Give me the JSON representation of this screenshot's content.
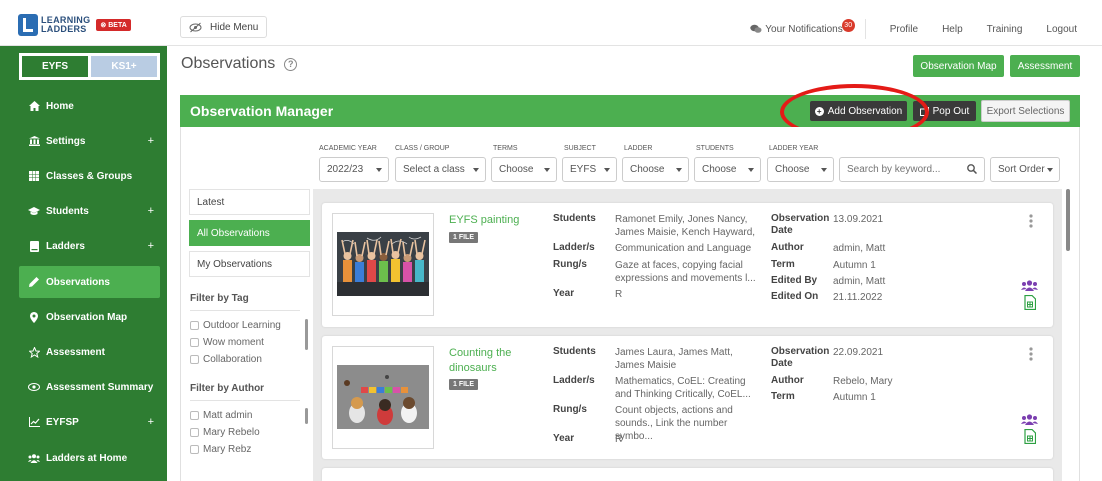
{
  "brand": {
    "line1": "LEARNING",
    "line2": "LADDERS",
    "beta": "⊗ BETA"
  },
  "topbar": {
    "hide_menu": "Hide Menu",
    "notifications": "Your Notifications",
    "notif_count": "30",
    "profile": "Profile",
    "help": "Help",
    "training": "Training",
    "logout": "Logout"
  },
  "stage_toggle": {
    "eyfs": "EYFS",
    "ks1": "KS1+"
  },
  "sidebar": {
    "items": [
      {
        "label": "Home",
        "icon": "home-icon",
        "plus": ""
      },
      {
        "label": "Settings",
        "icon": "settings-icon",
        "plus": "+"
      },
      {
        "label": "Classes & Groups",
        "icon": "grid-icon",
        "plus": ""
      },
      {
        "label": "Students",
        "icon": "graduation-cap-icon",
        "plus": "+"
      },
      {
        "label": "Ladders",
        "icon": "book-icon",
        "plus": "+"
      },
      {
        "label": "Observations",
        "icon": "pencil-icon",
        "plus": ""
      },
      {
        "label": "Observation Map",
        "icon": "map-pin-icon",
        "plus": ""
      },
      {
        "label": "Assessment",
        "icon": "star-icon",
        "plus": ""
      },
      {
        "label": "Assessment Summary",
        "icon": "eye-icon",
        "plus": ""
      },
      {
        "label": "EYFSP",
        "icon": "chart-line-icon",
        "plus": "+"
      },
      {
        "label": "Ladders at Home",
        "icon": "users-icon",
        "plus": ""
      }
    ]
  },
  "page": {
    "title": "Observations",
    "observation_map_button": "Observation Map",
    "assessment_button": "Assessment"
  },
  "manager": {
    "title": "Observation Manager",
    "add_observation": "Add Observation",
    "pop_out": "Pop Out",
    "export_selections": "Export Selections"
  },
  "filters": {
    "academic_year": {
      "label": "ACADEMIC YEAR",
      "value": "2022/23"
    },
    "class_group": {
      "label": "CLASS / GROUP",
      "value": "Select a class"
    },
    "terms": {
      "label": "TERMS",
      "value": "Choose"
    },
    "subject": {
      "label": "SUBJECT",
      "value": "EYFS"
    },
    "ladder": {
      "label": "LADDER",
      "value": "Choose"
    },
    "students": {
      "label": "STUDENTS",
      "value": "Choose"
    },
    "ladder_year": {
      "label": "LADDER YEAR",
      "value": "Choose"
    },
    "search_placeholder": "Search by keyword...",
    "sort_order": "Sort Order"
  },
  "left_panel": {
    "tabs": [
      "Latest",
      "All Observations",
      "My Observations"
    ],
    "filter_by_tag": "Filter by Tag",
    "tags": [
      "Outdoor Learning",
      "Wow moment",
      "Collaboration"
    ],
    "filter_by_author": "Filter by Author",
    "authors": [
      "Matt admin",
      "Mary Rebelo",
      "Mary Rebz"
    ]
  },
  "labels": {
    "students": "Students",
    "ladders": "Ladder/s",
    "rungs": "Rung/s",
    "year": "Year",
    "observation_date_1": "Observation",
    "observation_date_2": "Date",
    "author": "Author",
    "term": "Term",
    "edited_by": "Edited By",
    "edited_on": "Edited On"
  },
  "observations": [
    {
      "title": "EYFS painting",
      "files": "1 FILE",
      "students": "Ramonet Emily, Jones Nancy, James Maisie, Kench Hayward, ...",
      "ladders": "Communication and Language",
      "rungs": "Gaze at faces, copying facial expressions and movements l...",
      "year": "R",
      "date": "13.09.2021",
      "author": "admin, Matt",
      "term": "Autumn 1",
      "edited_by": "admin, Matt",
      "edited_on": "21.11.2022"
    },
    {
      "title": "Counting the dinosaurs",
      "files": "1 FILE",
      "students": "James Laura, James Matt, James Maisie",
      "ladders": "Mathematics, CoEL: Creating and Thinking Critically, CoEL...",
      "rungs": "Count objects, actions and sounds., Link the number symbo...",
      "year": "R",
      "date": "22.09.2021",
      "author": "Rebelo, Mary",
      "term": "Autumn 1"
    }
  ],
  "colors": {
    "sidebar_green": "#2e7d32",
    "accent_green": "#4caf50",
    "highlight_red": "#e41b17",
    "dark_button": "#3a3a3a"
  }
}
